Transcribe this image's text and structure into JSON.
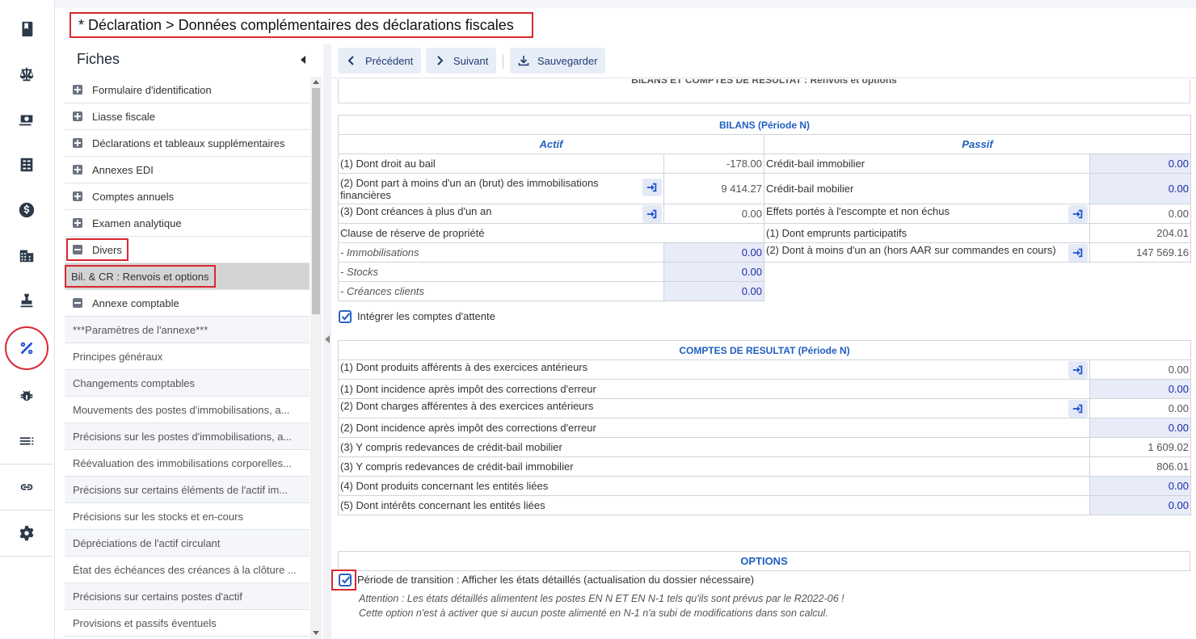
{
  "header": {
    "title": "* Déclaration > Données complémentaires des déclarations fiscales"
  },
  "rail": {
    "icons": [
      "book-icon",
      "scale-icon",
      "money-icon",
      "calculator-icon",
      "dollar-icon",
      "building-icon",
      "stamp-icon",
      "percent-icon",
      "bug-icon",
      "list-icon",
      "link-icon",
      "gear-icon"
    ],
    "active": "percent-icon"
  },
  "fiches": {
    "title": "Fiches",
    "groups": [
      {
        "label": "Formulaire d'identification",
        "state": "collapsed"
      },
      {
        "label": "Liasse fiscale",
        "state": "collapsed"
      },
      {
        "label": "Déclarations et tableaux supplémentaires",
        "state": "collapsed"
      },
      {
        "label": "Annexes EDI",
        "state": "collapsed"
      },
      {
        "label": "Comptes annuels",
        "state": "collapsed"
      },
      {
        "label": "Examen analytique",
        "state": "collapsed"
      },
      {
        "label": "Divers",
        "state": "expanded"
      }
    ],
    "selected": "Bil. & CR : Renvois et options",
    "annexe_group": "Annexe comptable",
    "annexe_items": [
      "***Paramètres de l'annexe***",
      "Principes généraux",
      "Changements comptables",
      "Mouvements des postes d'immobilisations, a...",
      "Précisions sur les postes d'immobilisations, a...",
      "Réévaluation des immobilisations corporelles...",
      "Précisions sur certains éléments de l'actif im...",
      "Précisions sur les stocks et en-cours",
      "Dépréciations de l'actif circulant",
      "État des échéances des créances à la clôture ...",
      "Précisions sur certains postes d'actif",
      "Provisions et passifs éventuels"
    ]
  },
  "toolbar": {
    "prev": "Précédent",
    "next": "Suivant",
    "save": "Sauvegarder"
  },
  "content": {
    "cut_title": "BILANS ET COMPTES DE RESULTAT : Renvois et options",
    "bilans": {
      "title": "BILANS (Période N)",
      "actif": "Actif",
      "passif": "Passif",
      "actif_rows": [
        {
          "label": "(1) Dont droit au bail",
          "value": "-178.00",
          "editable": false,
          "go": false
        },
        {
          "label": "(2) Dont part à moins d'un an (brut) des immobilisations financières",
          "value": "9 414.27",
          "editable": false,
          "go": true
        },
        {
          "label": "(3) Dont créances à plus d'un an",
          "value": "0.00",
          "editable": false,
          "go": true
        }
      ],
      "clause_label": "Clause de réserve de propriété",
      "clause_rows": [
        {
          "label": "- Immobilisations",
          "value": "0.00"
        },
        {
          "label": "- Stocks",
          "value": "0.00"
        },
        {
          "label": "- Créances clients",
          "value": "0.00"
        }
      ],
      "passif_rows": [
        {
          "label": "Crédit-bail immobilier",
          "value": "0.00",
          "editable": true,
          "go": false
        },
        {
          "label": "Crédit-bail mobilier",
          "value": "0.00",
          "editable": true,
          "go": false
        },
        {
          "label": "Effets portés à l'escompte et non échus",
          "value": "0.00",
          "editable": false,
          "go": true
        },
        {
          "label": "(1) Dont emprunts participatifs",
          "value": "204.01",
          "editable": false,
          "go": false
        },
        {
          "label": "(2) Dont à moins d'un an (hors AAR sur commandes en cours)",
          "value": "147 569.16",
          "editable": false,
          "go": true
        }
      ]
    },
    "integrer_label": "Intégrer les comptes d'attente",
    "resultat": {
      "title": "COMPTES DE RESULTAT (Période N)",
      "rows": [
        {
          "label": "(1) Dont produits afférents à des exercices antérieurs",
          "value": "0.00",
          "editable": false,
          "go": true
        },
        {
          "label": "(1) Dont incidence après impôt des corrections d'erreur",
          "value": "0.00",
          "editable": true,
          "go": false
        },
        {
          "label": "(2) Dont charges afférentes à des exercices antérieurs",
          "value": "0.00",
          "editable": false,
          "go": true
        },
        {
          "label": "(2) Dont incidence après impôt des corrections d'erreur",
          "value": "0.00",
          "editable": true,
          "go": false
        },
        {
          "label": "(3) Y compris redevances de crédit-bail mobilier",
          "value": "1 609.02",
          "editable": false,
          "go": false
        },
        {
          "label": "(3) Y compris redevances de crédit-bail immobilier",
          "value": "806.01",
          "editable": false,
          "go": false
        },
        {
          "label": "(4) Dont produits concernant les entités liées",
          "value": "0.00",
          "editable": true,
          "go": false
        },
        {
          "label": "(5) Dont intérêts concernant les entités liées",
          "value": "0.00",
          "editable": true,
          "go": false
        }
      ]
    },
    "options": {
      "title": "OPTIONS",
      "transition_label": "Période de transition : Afficher les états détaillés (actualisation du dossier nécessaire)",
      "note1": "Attention : Les états détaillés alimentent les postes EN N ET EN N-1 tels qu'ils sont prévus par le R2022-06 !",
      "note2": "Cette option n'est à activer que si aucun poste alimenté en N-1 n'a subi de modifications dans son calcul."
    }
  }
}
